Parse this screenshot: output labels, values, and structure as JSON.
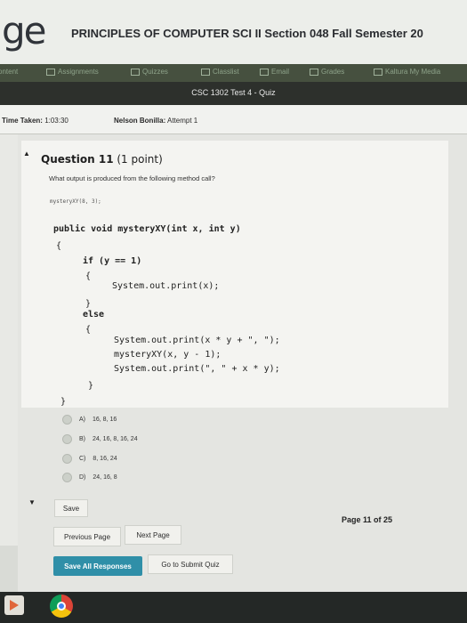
{
  "header": {
    "logo": "ge",
    "course_title": "PRINCIPLES OF COMPUTER SCI II Section 048 Fall Semester 20"
  },
  "nav": [
    {
      "label": "ontent",
      "icon": "content-icon"
    },
    {
      "label": "Assignments",
      "icon": "assignments-icon"
    },
    {
      "label": "Quizzes",
      "icon": "quizzes-icon"
    },
    {
      "label": "Classlist",
      "icon": "classlist-icon"
    },
    {
      "label": "Email",
      "icon": "email-icon"
    },
    {
      "label": "Grades",
      "icon": "grades-icon"
    },
    {
      "label": "Kaltura My Media",
      "icon": "kaltura-icon"
    }
  ],
  "quiz": {
    "title": "CSC 1302 Test 4 - Quiz"
  },
  "info": {
    "time_label": "Time Taken:",
    "time_value": "1:03:30",
    "student_name": "Nelson Bonilla:",
    "attempt": "Attempt 1"
  },
  "question": {
    "number": "Question 11",
    "points": "(1 point)",
    "prompt": "What output is produced from the following method call?",
    "call": "mysteryXY(8, 3);",
    "code": [
      "public void mysteryXY(int x, int y)",
      "{",
      "if (y == 1)",
      "{",
      "System.out.print(x);",
      "}",
      "else",
      "{",
      "System.out.print(x * y + \", \");",
      "mysteryXY(x, y - 1);",
      "System.out.print(\", \" + x * y);",
      "}",
      "}"
    ],
    "options": [
      {
        "letter": "A)",
        "text": "16, 8, 16"
      },
      {
        "letter": "B)",
        "text": "24, 16, 8, 16, 24"
      },
      {
        "letter": "C)",
        "text": "8, 16, 24"
      },
      {
        "letter": "D)",
        "text": "24, 16, 8"
      }
    ]
  },
  "buttons": {
    "save": "Save",
    "previous": "Previous Page",
    "next": "Next Page",
    "save_all": "Save All Responses",
    "submit": "Go to Submit Quiz"
  },
  "pagination": {
    "page_label": "Page 11 of 25"
  }
}
